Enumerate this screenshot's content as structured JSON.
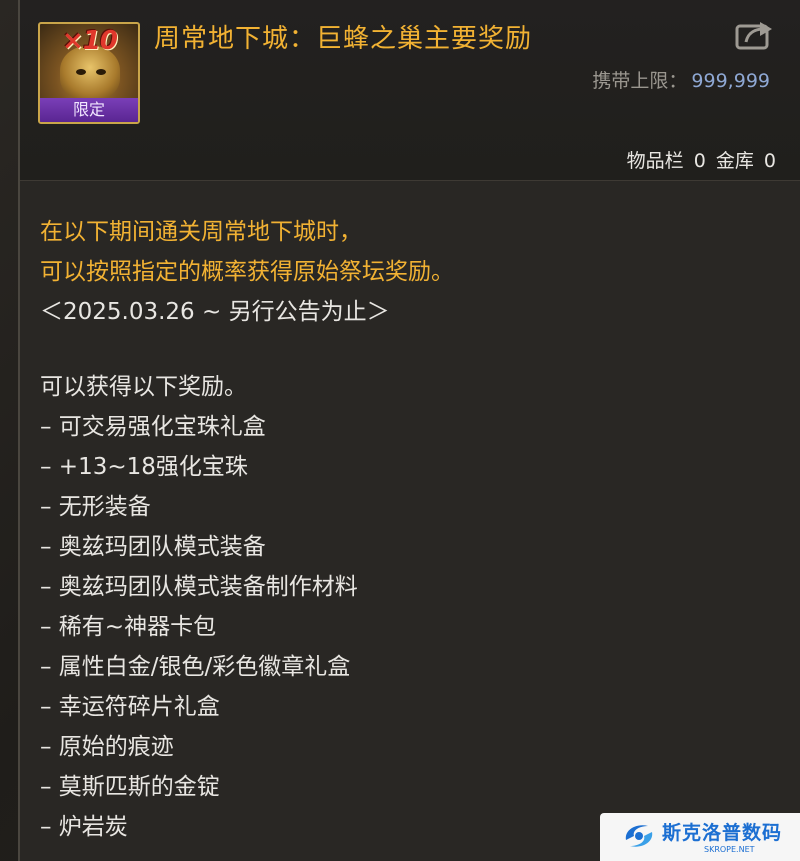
{
  "item": {
    "multiplier": "×10",
    "limited_badge": "限定",
    "title": "周常地下城：巨蜂之巢主要奖励",
    "carry_limit_label": "携带上限：",
    "carry_limit_value": "999,999",
    "inventory_label": "物品栏",
    "inventory_count": "0",
    "vault_label": "金库",
    "vault_count": "0"
  },
  "description": {
    "line1": "在以下期间通关周常地下城时，",
    "line2": "可以按照指定的概率获得原始祭坛奖励。",
    "period": "＜2025.03.26 ~ 另行公告为止＞",
    "rewards_intro": "可以获得以下奖励。",
    "rewards": [
      "– 可交易强化宝珠礼盒",
      "– +13~18强化宝珠",
      "– 无形装备",
      "– 奥兹玛团队模式装备",
      "– 奥兹玛团队模式装备制作材料",
      "– 稀有~神器卡包",
      "– 属性白金/银色/彩色徽章礼盒",
      "– 幸运符碎片礼盒",
      "– 原始的痕迹",
      "– 莫斯匹斯的金锭",
      "– 炉岩炭"
    ]
  },
  "watermark": {
    "name": "斯克洛普数码",
    "sub": "SKROPE.NET"
  },
  "icons": {
    "share": "share-external-icon",
    "item": "bee-nest-reward-icon"
  },
  "colors": {
    "title": "#f2b233",
    "limit_value": "#8fa8d4",
    "limited_badge": "#6a32a6",
    "watermark_blue": "#1c6fd2"
  }
}
